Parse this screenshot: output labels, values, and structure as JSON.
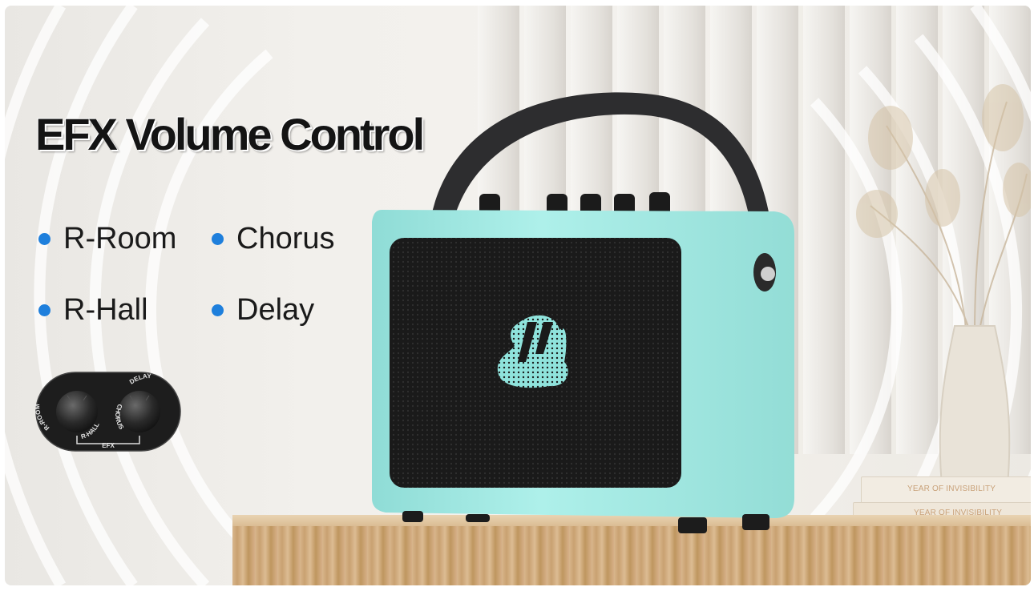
{
  "title": "EFX Volume Control",
  "features": [
    "R-Room",
    "Chorus",
    "R-Hall",
    "Delay"
  ],
  "knob_labels": {
    "left_outer": "R-ROOM",
    "left_inner": "R-HALL",
    "right_inner": "CHORUS",
    "right_outer": "DELAY",
    "bottom": "EFX"
  },
  "book_titles": [
    "YEAR OF INVISIBILITY",
    "YEAR OF INVISIBILITY"
  ],
  "colors": {
    "bullet": "#1e7fdc",
    "amp_body": "#a8ece6",
    "grille": "#1c1c1c",
    "strap": "#2d2d2f",
    "title_text": "#141414"
  }
}
